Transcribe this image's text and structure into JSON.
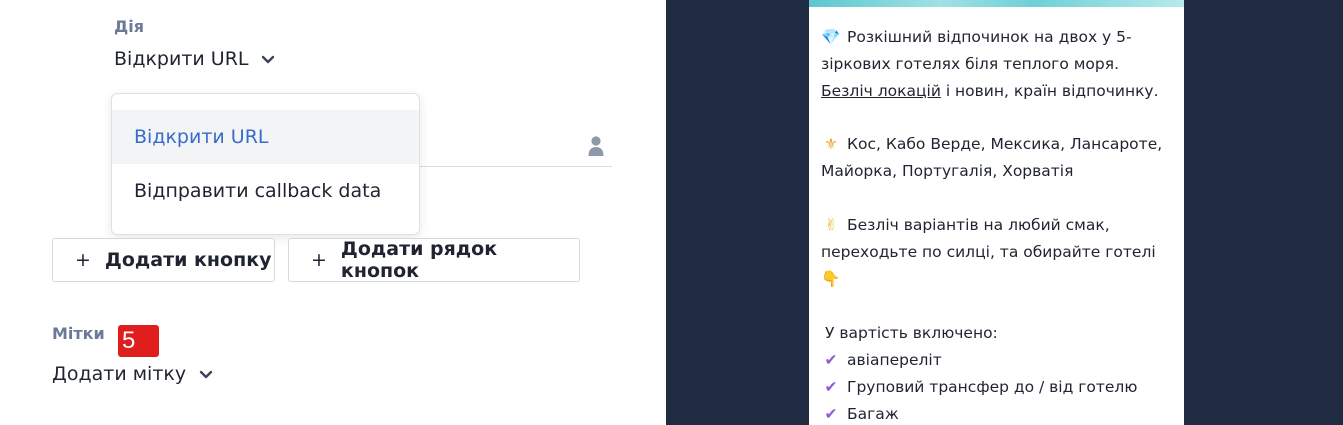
{
  "editor": {
    "action_label": "Дія",
    "action_value": "Відкрити URL",
    "dropdown_options": [
      "Відкрити URL",
      "Відправити callback data"
    ],
    "add_button_label": "Додати кнопку",
    "add_row_label": "Додати рядок кнопок",
    "plus_glyph": "+",
    "tags_label": "Мітки",
    "tags_value": "Додати мітку",
    "step_badge": "5"
  },
  "preview": {
    "p1_emoji": "💎",
    "p1_line": "Розкішний відпочинок на двох у 5-зіркових готелях біля теплого моря.",
    "p1_link": "Безліч локацій",
    "p1_tail": " і новин, країн відпочинку.",
    "p2_emoji": "⚜",
    "p2_text": "Кос, Кабо Верде, Мексика, Лансароте, Майорка, Португалія, Хорватія",
    "p3_emoji": "✌",
    "p3_text": "Безліч варіантів на любий смак, переходьте по силці, та обирайте готелі",
    "p3_emoji_end": "👇",
    "included_title": "У вартість включено:",
    "check_glyph": "✔",
    "included_items": [
      "авіапереліт",
      "Груповий трансфер до / від готелю",
      "Багаж"
    ]
  },
  "colors": {
    "accent_blue": "#3a6bc9",
    "badge_red": "#e01e1e",
    "preview_bg": "#202a40",
    "check_purple": "#8a5fd3"
  }
}
